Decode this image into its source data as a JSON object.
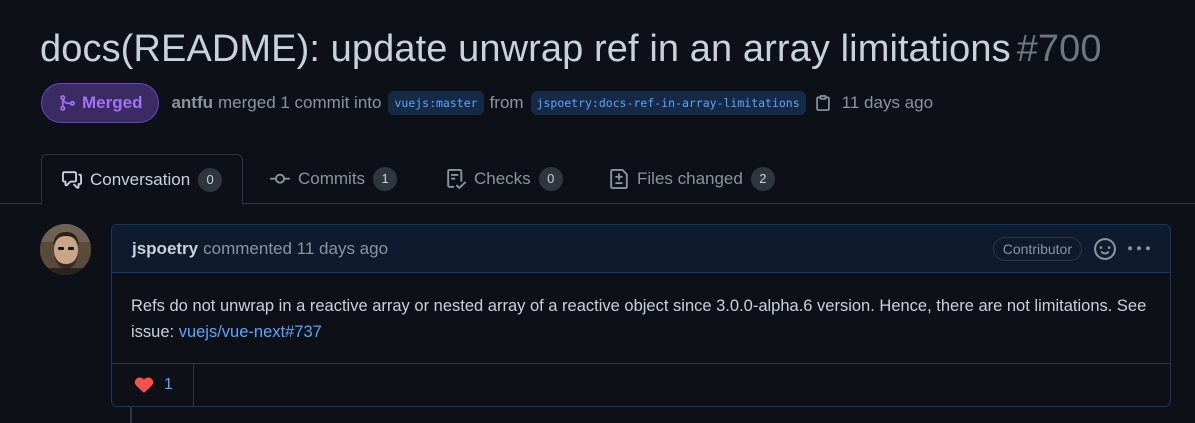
{
  "pr": {
    "title": "docs(README): update unwrap ref in an array limitations",
    "number": "#700",
    "state_label": "Merged",
    "author": "antfu",
    "merge_text": "merged 1 commit into",
    "base_branch": "vuejs:master",
    "from_text": "from",
    "head_branch": "jspoetry:docs-ref-in-array-limitations",
    "time": "11 days ago"
  },
  "tabs": [
    {
      "label": "Conversation",
      "count": "0",
      "icon": "conversation-icon"
    },
    {
      "label": "Commits",
      "count": "1",
      "icon": "commit-icon"
    },
    {
      "label": "Checks",
      "count": "0",
      "icon": "checklist-icon"
    },
    {
      "label": "Files changed",
      "count": "2",
      "icon": "file-diff-icon"
    }
  ],
  "comment": {
    "author": "jspoetry",
    "action": "commented 11 days ago",
    "role_badge": "Contributor",
    "body_text": "Refs do not unwrap in a reactive array or nested array of a reactive object since 3.0.0-alpha.6 version. Hence, there are not limitations. See issue:",
    "link_text": "vuejs/vue-next#737",
    "reaction": {
      "icon": "heart-icon",
      "count": "1"
    }
  },
  "colors": {
    "background": "#0d1117",
    "merged_purple": "#a371f7",
    "link_blue": "#58a6ff",
    "heart_red": "#f85149"
  }
}
